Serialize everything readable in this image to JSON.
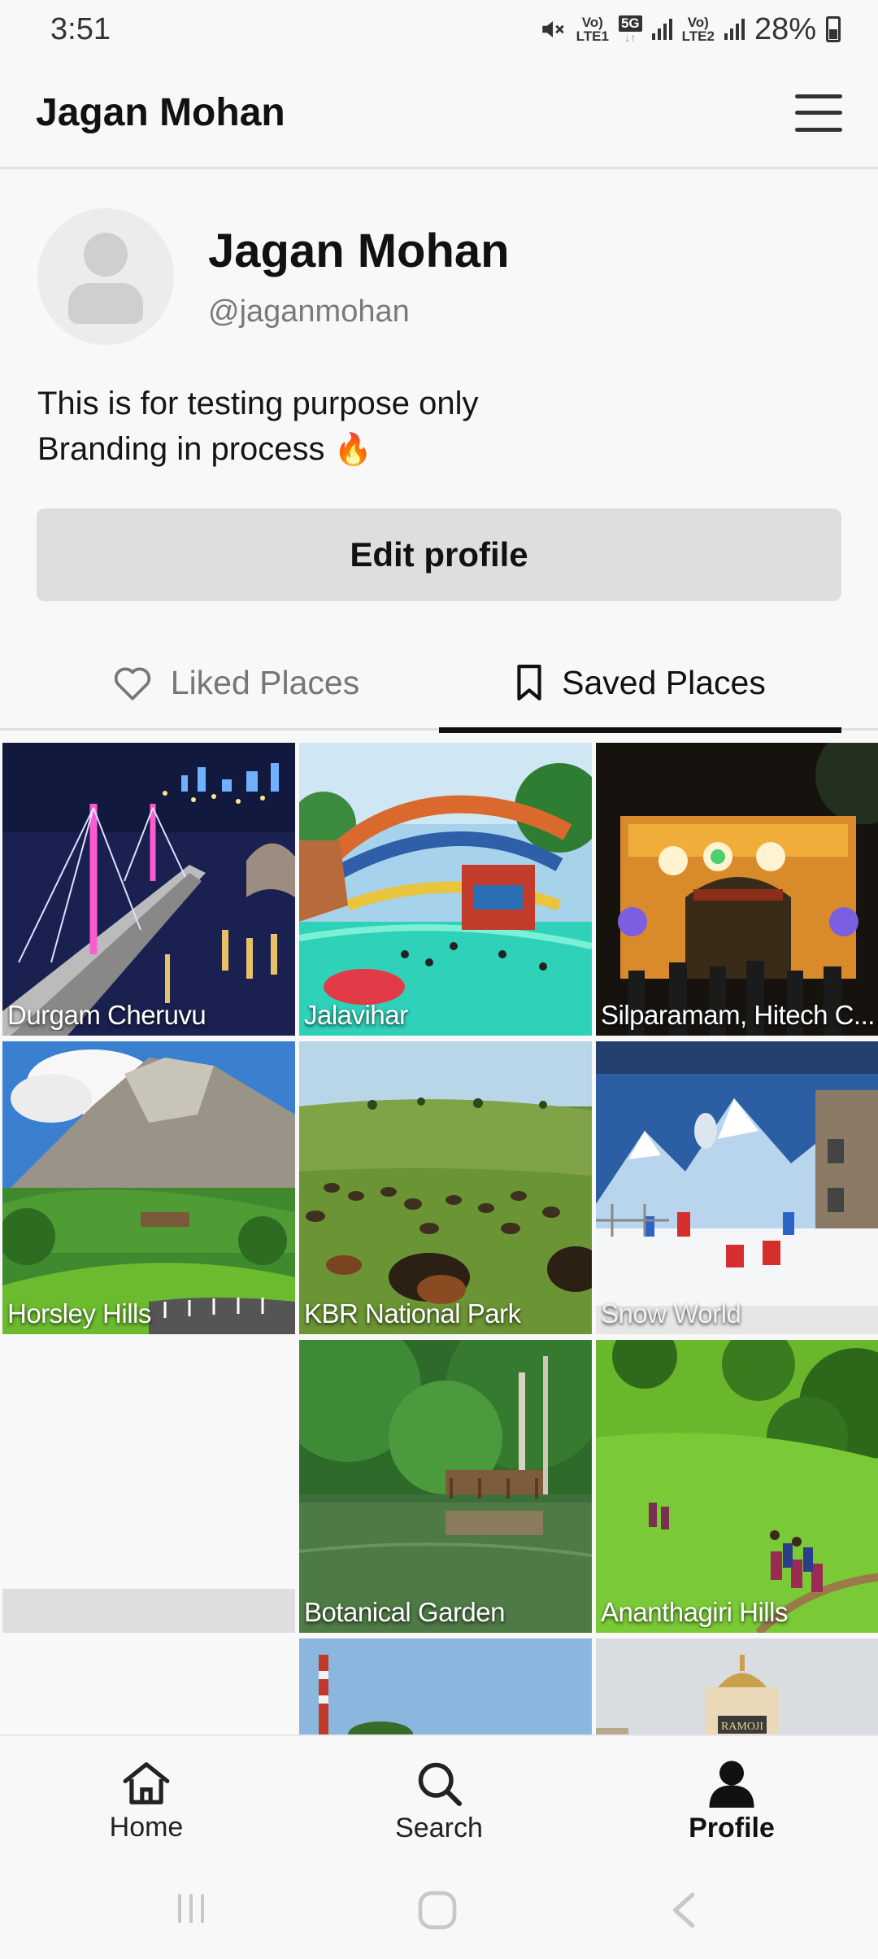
{
  "status_bar": {
    "time": "3:51",
    "net1_top": "Vo)",
    "net1_bottom": "LTE1",
    "net_5g": "5G",
    "net2_top": "Vo)",
    "net2_bottom": "LTE2",
    "battery": "28%"
  },
  "header": {
    "title": "Jagan Mohan"
  },
  "profile": {
    "name": "Jagan Mohan",
    "handle": "@jaganmohan",
    "bio_line1": "This is for testing purpose only",
    "bio_line2": "Branding in process",
    "bio_emoji": "🔥",
    "edit_label": "Edit profile"
  },
  "tabs": {
    "liked": "Liked Places",
    "saved": "Saved Places"
  },
  "places": [
    {
      "name": "Durgam Cheruvu"
    },
    {
      "name": "Jalavihar"
    },
    {
      "name": "Silparamam, Hitech C..."
    },
    {
      "name": "Horsley Hills"
    },
    {
      "name": "KBR National Park"
    },
    {
      "name": "Snow World"
    },
    {
      "name": ""
    },
    {
      "name": "Botanical Garden"
    },
    {
      "name": "Ananthagiri Hills"
    }
  ],
  "partial_tile": {
    "sign_text": "RAMOJI"
  },
  "bottom_nav": {
    "home": "Home",
    "search": "Search",
    "profile": "Profile"
  }
}
